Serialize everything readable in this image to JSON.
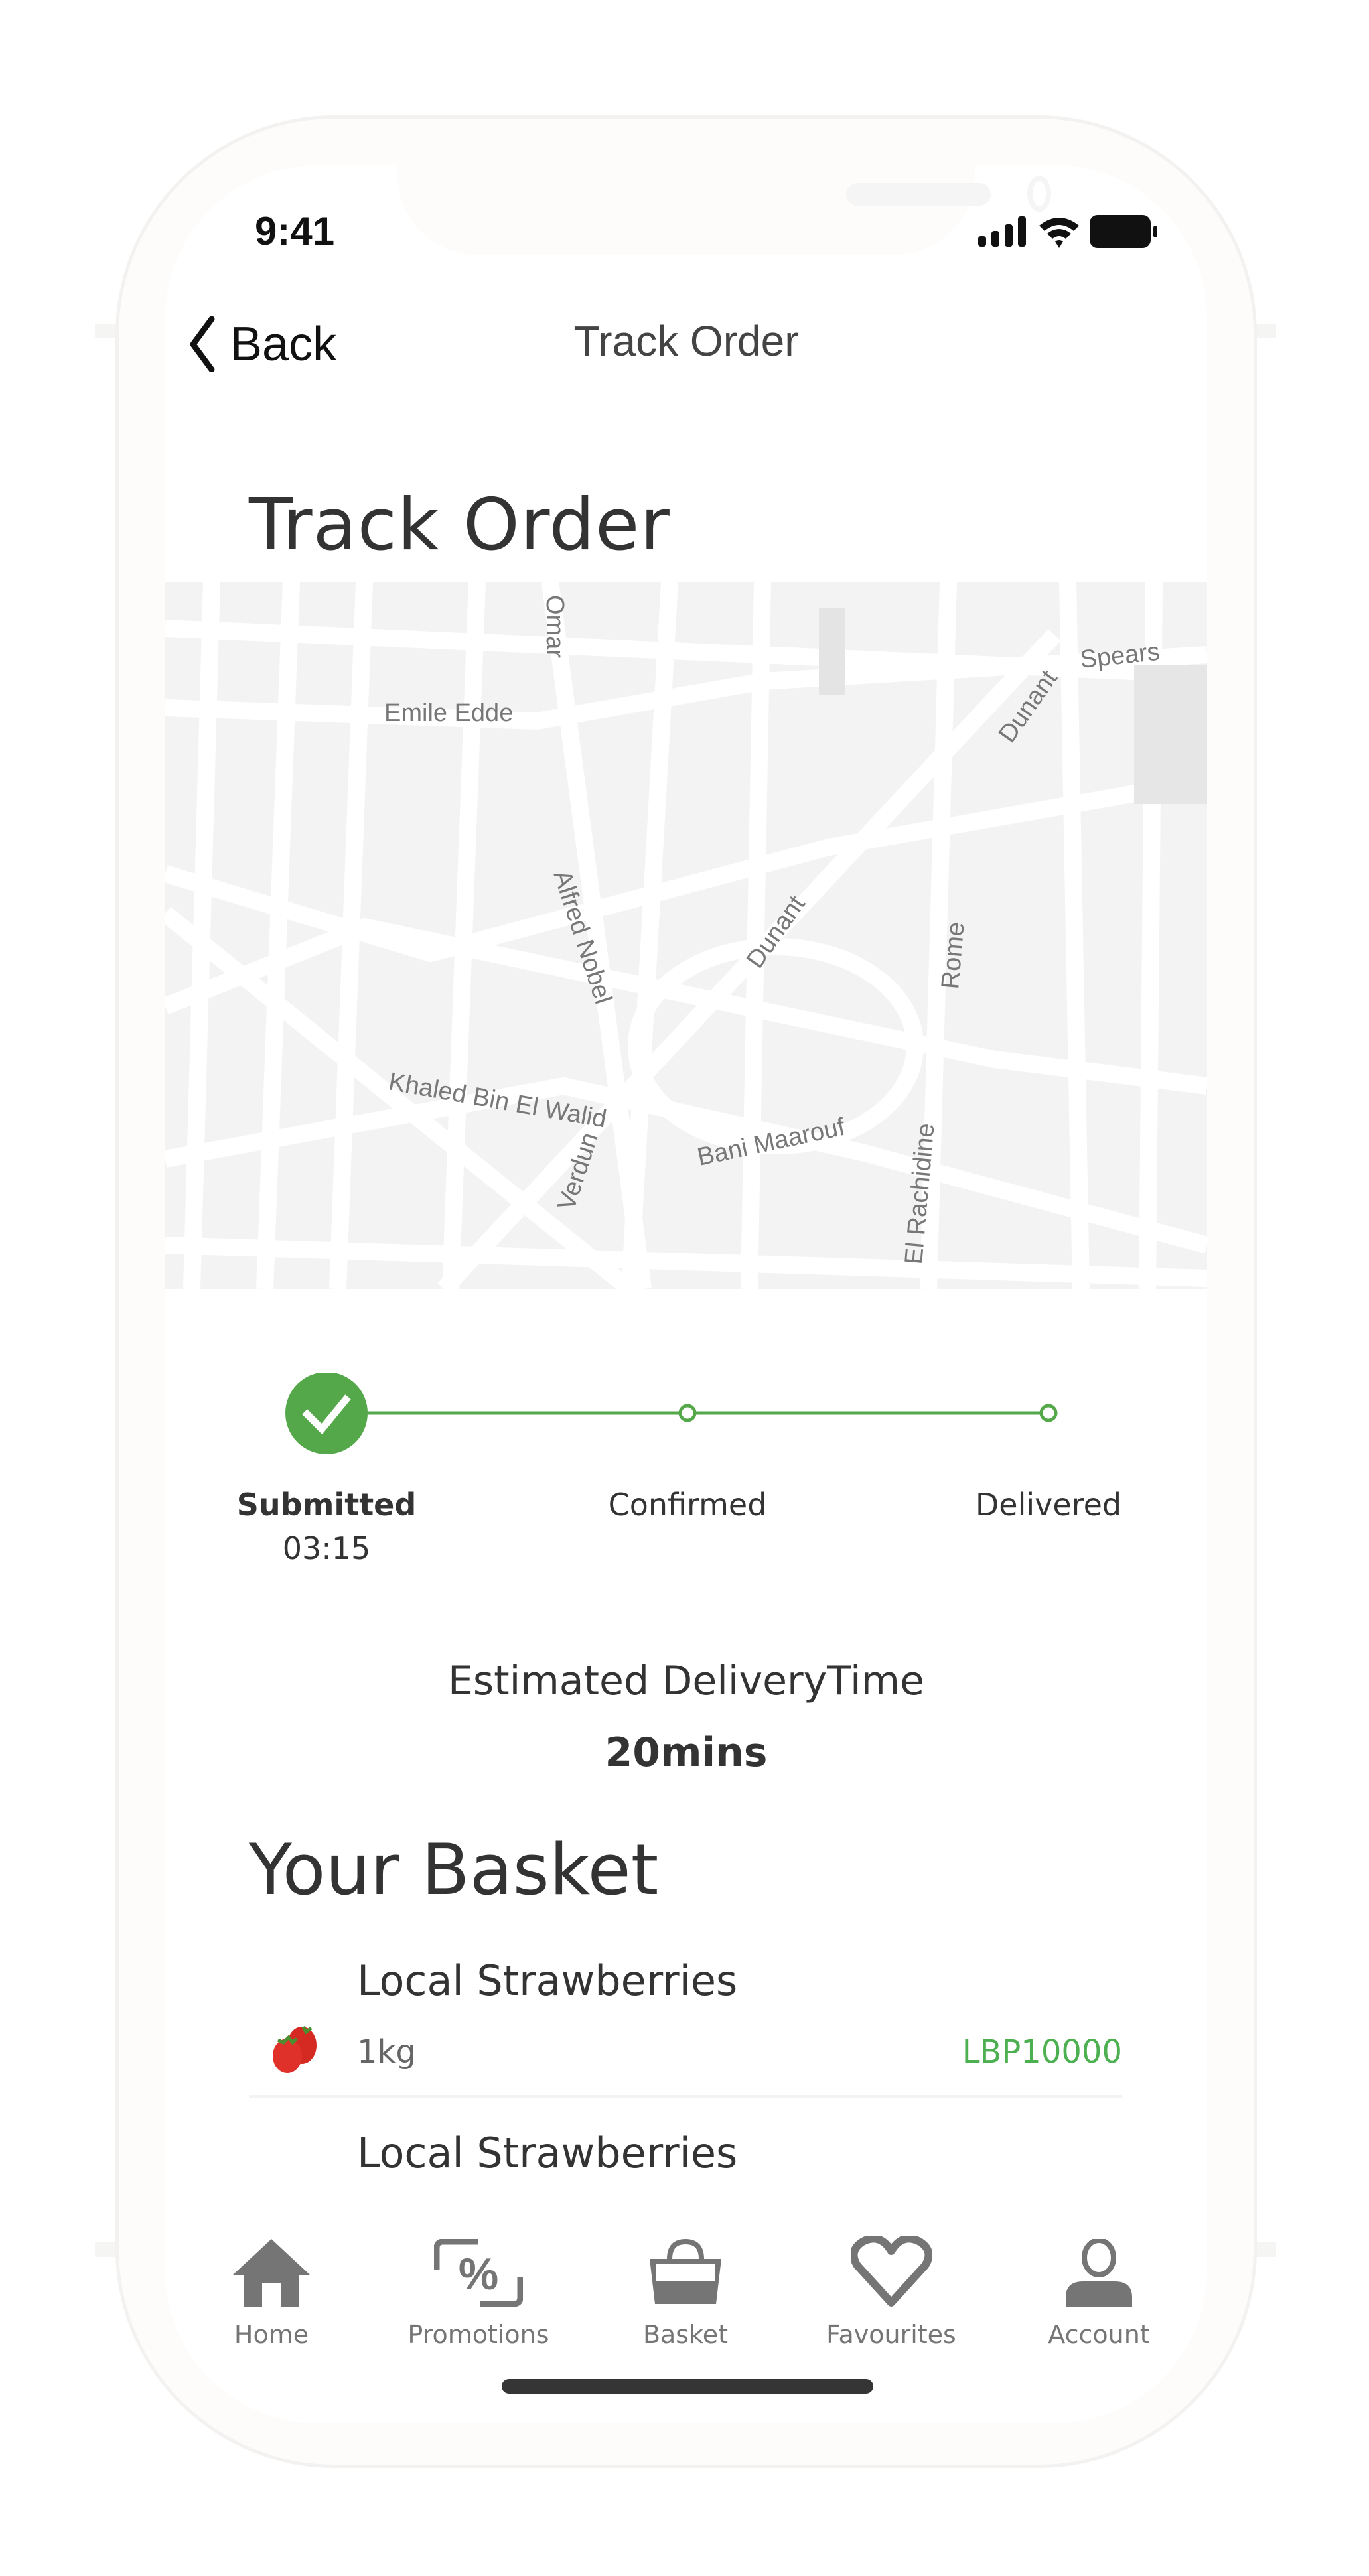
{
  "status_bar": {
    "time": "9:41",
    "icons": [
      "signal-icon",
      "wifi-icon",
      "battery-icon"
    ]
  },
  "nav": {
    "back_label": "Back",
    "title": "Track Order"
  },
  "page": {
    "title": "Track Order"
  },
  "map": {
    "street_labels": [
      "Omar",
      "Emile Edde",
      "Spears",
      "Dunant",
      "Alfred Nobel",
      "Dunant",
      "Rome",
      "Khaled Bin El Walid",
      "Verdun",
      "Bani Maarouf",
      "El Rachidine"
    ],
    "colors": {
      "background": "#f3f3f3",
      "road": "#ffffff",
      "building": "#e6e6e6"
    }
  },
  "progress": {
    "accent": "#54a84a",
    "current_step": 1,
    "total_steps": 3,
    "steps": [
      {
        "label": "Submitted",
        "time": "03:15",
        "done": true
      },
      {
        "label": "Confirmed",
        "time": "",
        "done": false
      },
      {
        "label": "Delivered",
        "time": "",
        "done": false
      }
    ]
  },
  "eta": {
    "label": "Estimated DeliveryTime",
    "value": "20mins"
  },
  "basket": {
    "title": "Your Basket",
    "items": [
      {
        "name": "Local Strawberries",
        "quantity": "1kg",
        "price": "LBP10000",
        "icon": "strawberry-icon"
      },
      {
        "name": "Local Strawberries",
        "quantity": "",
        "price": "",
        "icon": "strawberry-icon"
      }
    ]
  },
  "tabbar": {
    "items": [
      {
        "label": "Home",
        "icon": "home-icon"
      },
      {
        "label": "Promotions",
        "icon": "promotions-icon"
      },
      {
        "label": "Basket",
        "icon": "basket-icon"
      },
      {
        "label": "Favourites",
        "icon": "heart-icon"
      },
      {
        "label": "Account",
        "icon": "account-icon"
      }
    ],
    "icon_color": "#757575"
  }
}
